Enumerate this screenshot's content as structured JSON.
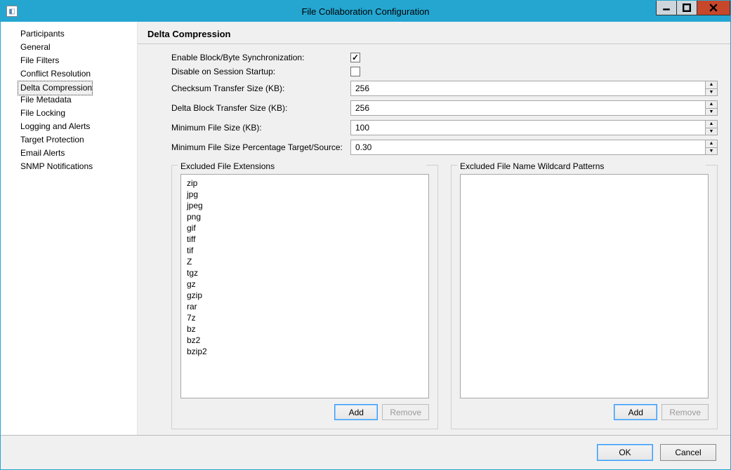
{
  "window": {
    "title": "File Collaboration Configuration"
  },
  "sidebar": {
    "items": [
      {
        "label": "Participants",
        "selected": false
      },
      {
        "label": "General",
        "selected": false
      },
      {
        "label": "File Filters",
        "selected": false
      },
      {
        "label": "Conflict Resolution",
        "selected": false
      },
      {
        "label": "Delta Compression",
        "selected": true
      },
      {
        "label": "File Metadata",
        "selected": false
      },
      {
        "label": "File Locking",
        "selected": false
      },
      {
        "label": "Logging and Alerts",
        "selected": false
      },
      {
        "label": "Target Protection",
        "selected": false
      },
      {
        "label": "Email Alerts",
        "selected": false
      },
      {
        "label": "SNMP Notifications",
        "selected": false
      }
    ]
  },
  "page": {
    "heading": "Delta Compression",
    "fields": {
      "enable_label": "Enable Block/Byte Synchronization:",
      "enable_checked": true,
      "disable_startup_label": "Disable on Session Startup:",
      "disable_startup_checked": false,
      "checksum_label": "Checksum Transfer Size (KB):",
      "checksum_value": "256",
      "delta_block_label": "Delta Block Transfer Size (KB):",
      "delta_block_value": "256",
      "min_size_label": "Minimum File Size (KB):",
      "min_size_value": "100",
      "min_pct_label": "Minimum File Size Percentage Target/Source:",
      "min_pct_value": "0.30"
    },
    "group_ext": {
      "title": "Excluded File Extensions",
      "items": [
        "zip",
        "jpg",
        "jpeg",
        "png",
        "gif",
        "tiff",
        "tif",
        "Z",
        "tgz",
        "gz",
        "gzip",
        "rar",
        "7z",
        "bz",
        "bz2",
        "bzip2"
      ],
      "add_label": "Add",
      "remove_label": "Remove",
      "remove_enabled": false
    },
    "group_wild": {
      "title": "Excluded File Name Wildcard Patterns",
      "items": [],
      "add_label": "Add",
      "remove_label": "Remove",
      "remove_enabled": false
    }
  },
  "footer": {
    "ok_label": "OK",
    "cancel_label": "Cancel"
  }
}
